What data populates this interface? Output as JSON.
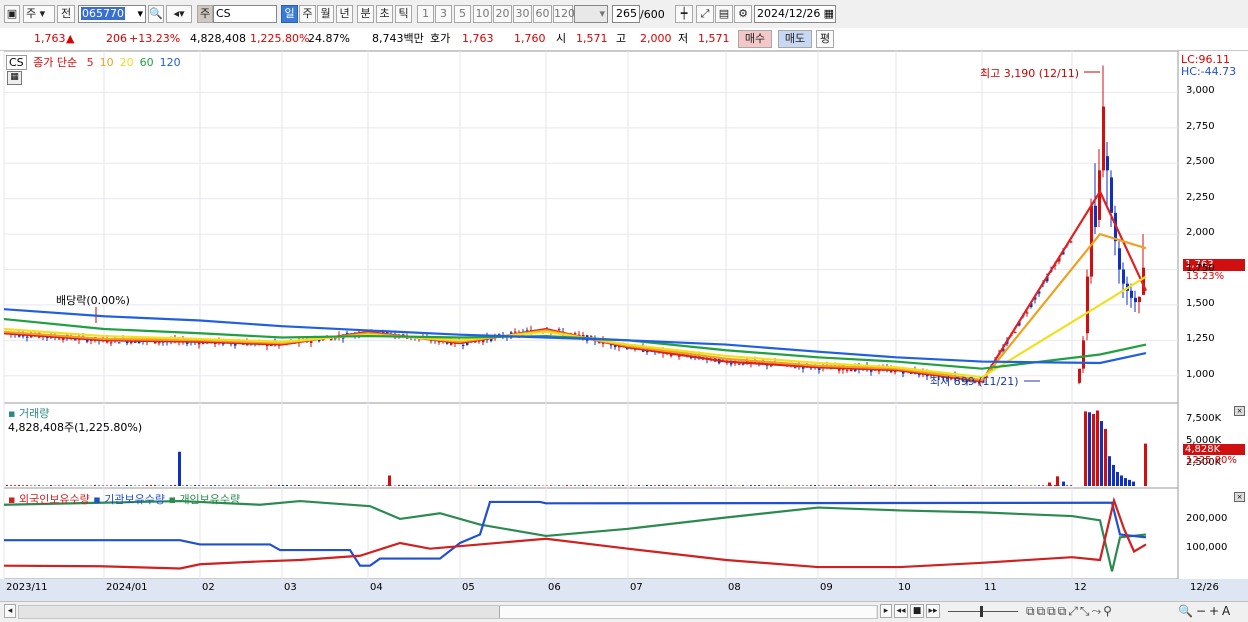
{
  "toolbar": {
    "mode": "주",
    "prev": "전",
    "code": "065770",
    "market_tag": "주",
    "name": "CS",
    "periods": [
      "일",
      "주",
      "월",
      "년",
      "분",
      "초",
      "틱"
    ],
    "selected_period": "일",
    "intervals": [
      "1",
      "3",
      "5",
      "10",
      "20",
      "30",
      "60",
      "120"
    ],
    "count": "265",
    "max": "/600",
    "date": "2024/12/26"
  },
  "quote": {
    "price": "1,763",
    "arrow": "▲",
    "change": "206",
    "change_pct": "+13.23%",
    "volume": "4,828,408",
    "volume_pct": "1,225.80%",
    "turnover": "24.87%",
    "amount": "8,743백만",
    "bid_label": "호가",
    "bid1": "1,763",
    "bid2": "1,760",
    "open_label": "시",
    "open": "1,571",
    "high_label": "고",
    "high": "2,000",
    "low_label": "저",
    "low": "1,571",
    "buy_btn": "매수",
    "sell_btn": "매도",
    "eval_btn": "평"
  },
  "price_panel": {
    "tag": "CS",
    "legend_title": "종가 단순",
    "ma": [
      {
        "label": "5",
        "color": "#e02020"
      },
      {
        "label": "10",
        "color": "#f0a020"
      },
      {
        "label": "20",
        "color": "#f0e020"
      },
      {
        "label": "60",
        "color": "#20a040"
      },
      {
        "label": "120",
        "color": "#2060e0"
      }
    ],
    "lc": "LC:96.11",
    "hc": "HC:-44.73",
    "high_note": "최고 3,190 (12/11)",
    "low_note": "최저 899 (11/21)",
    "dividend_note": "배당락(0.00%)",
    "current_price": "1,763",
    "current_pct": "13.23%",
    "y_ticks": [
      "3,000",
      "2,750",
      "2,500",
      "2,250",
      "2,000",
      "1,750",
      "1,500",
      "1,250",
      "1,000"
    ]
  },
  "volume_panel": {
    "title": "거래량",
    "value": "4,828,408주(1,225.80%)",
    "y_ticks": [
      "7,500K",
      "5,000K",
      "2,500K"
    ],
    "current": "4,828K",
    "current_pct": "1225.80%"
  },
  "holders_panel": {
    "labels": [
      {
        "text": "외국인보유수량",
        "color": "#d02020"
      },
      {
        "text": "기관보유수량",
        "color": "#2050d0"
      },
      {
        "text": "개인보유수량",
        "color": "#2a8a50"
      }
    ],
    "y_ticks": [
      "200,000",
      "100,000"
    ]
  },
  "x_axis": [
    "2023/11",
    "2024/01",
    "02",
    "03",
    "04",
    "05",
    "06",
    "07",
    "08",
    "09",
    "10",
    "11",
    "12",
    "12/26"
  ],
  "chart_data": {
    "type": "line",
    "x": [
      "2023-11",
      "2024-01",
      "2024-02",
      "2024-03",
      "2024-04",
      "2024-05",
      "2024-06",
      "2024-07",
      "2024-08",
      "2024-09",
      "2024-10",
      "2024-11",
      "2024-12-11",
      "2024-12-26"
    ],
    "series": [
      {
        "name": "5",
        "values": [
          1300,
          1250,
          1240,
          1220,
          1310,
          1230,
          1330,
          1200,
          1100,
          1060,
          1040,
          960,
          2300,
          1600
        ]
      },
      {
        "name": "10",
        "values": [
          1310,
          1260,
          1250,
          1230,
          1300,
          1240,
          1320,
          1210,
          1120,
          1070,
          1050,
          970,
          2000,
          1900
        ]
      },
      {
        "name": "20",
        "values": [
          1330,
          1280,
          1260,
          1240,
          1290,
          1250,
          1310,
          1220,
          1140,
          1090,
          1060,
          990,
          1500,
          1700
        ]
      },
      {
        "name": "60",
        "values": [
          1400,
          1330,
          1300,
          1270,
          1280,
          1270,
          1280,
          1250,
          1180,
          1130,
          1100,
          1050,
          1150,
          1220
        ]
      },
      {
        "name": "120",
        "values": [
          1470,
          1420,
          1390,
          1350,
          1320,
          1290,
          1270,
          1250,
          1220,
          1170,
          1130,
          1100,
          1090,
          1160
        ]
      }
    ],
    "ylim": [
      850,
      3250
    ],
    "high": 3190,
    "low": 899,
    "last": 1763
  }
}
